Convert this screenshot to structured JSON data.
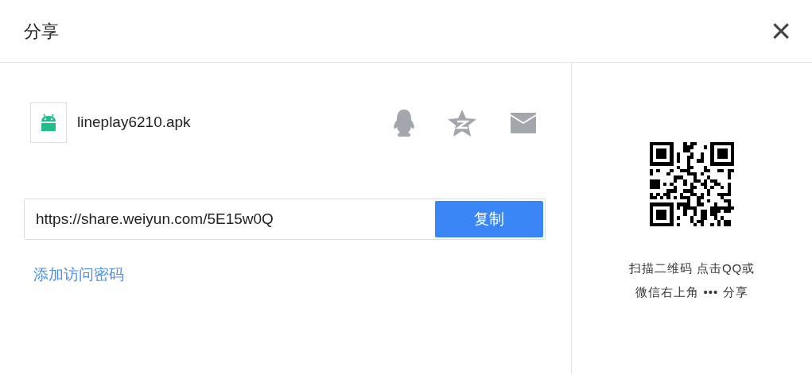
{
  "dialog": {
    "title": "分享",
    "close": "×"
  },
  "file": {
    "name": "lineplay6210.apk"
  },
  "share_link": {
    "value": "https://share.weiyun.com/5E15w0Q",
    "button": "复制"
  },
  "add_password_link": "添加访问密码",
  "qr_caption": [
    "扫描二维码 点击QQ或",
    "微信右上角 ••• 分享"
  ]
}
